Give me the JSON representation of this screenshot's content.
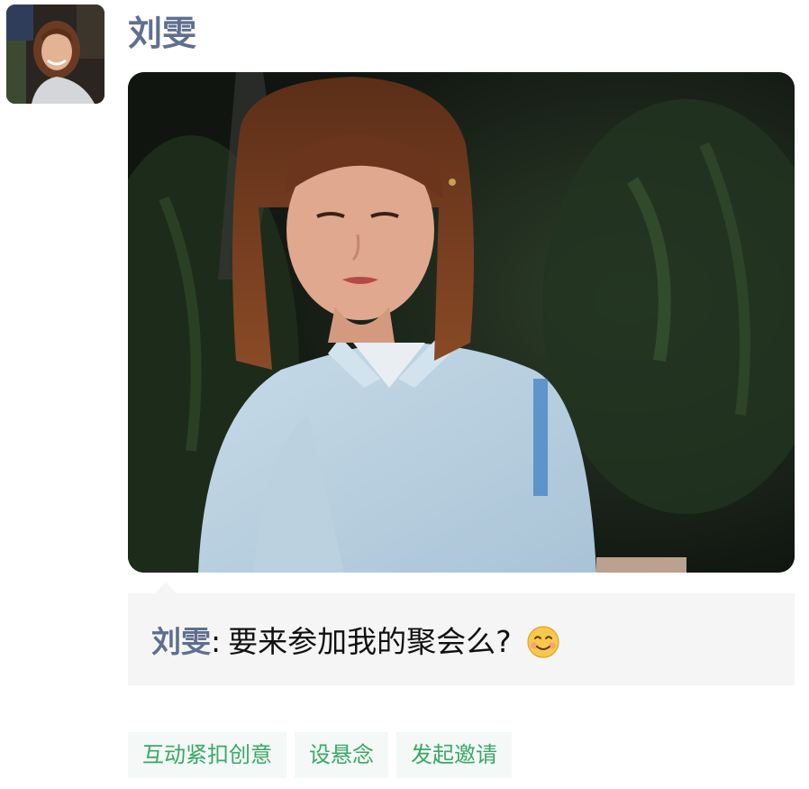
{
  "post": {
    "author": "刘雯",
    "avatar_icon": "user-avatar-photo",
    "photo_icon": "post-photo"
  },
  "comment": {
    "author": "刘雯",
    "separator": ":",
    "text": "要来参加我的聚会么?",
    "emoji_icon": "smiling-face-emoji"
  },
  "actions": [
    {
      "label": "互动紧扣创意"
    },
    {
      "label": "设悬念"
    },
    {
      "label": "发起邀请"
    }
  ],
  "colors": {
    "name": "#5f6f8f",
    "tag_text": "#3aa868",
    "tag_bg": "#f4f8f6",
    "comment_bg": "#f5f5f5"
  }
}
